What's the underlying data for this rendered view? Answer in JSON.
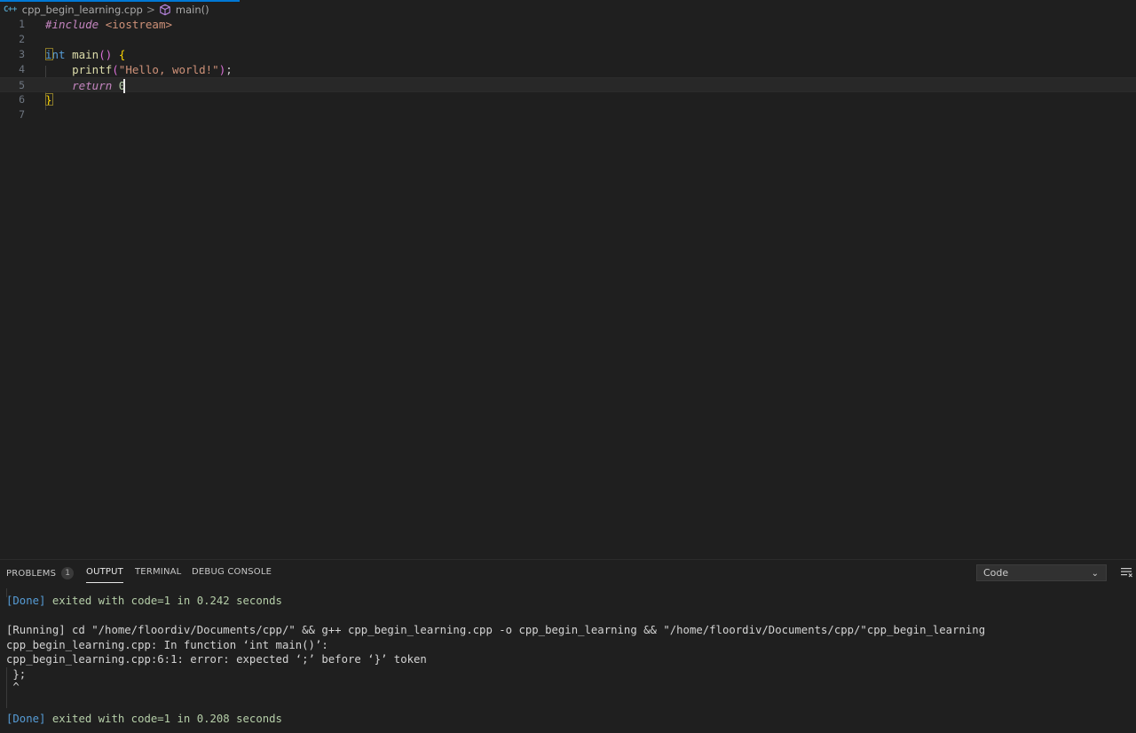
{
  "breadcrumb": {
    "file_icon": "C++",
    "file": "cpp_begin_learning.cpp",
    "separator": ">",
    "symbol": "main()"
  },
  "editor": {
    "line_numbers": [
      "1",
      "2",
      "3",
      "4",
      "5",
      "6",
      "7"
    ],
    "tokens": {
      "l1_directive": "#include",
      "l1_header": "<iostream>",
      "l3_type": "int",
      "l3_fn": "main",
      "l3_parens": "()",
      "l3_brace": "{",
      "l4_fn": "printf",
      "l4_paren_open": "(",
      "l4_string": "\"Hello, world!\"",
      "l4_paren_close": ")",
      "l4_semicolon": ";",
      "l5_return": "return",
      "l5_value": "0",
      "l6_brace": "}"
    }
  },
  "panel": {
    "tabs": {
      "problems": "PROBLEMS",
      "problems_count": "1",
      "output": "OUTPUT",
      "terminal": "TERMINAL",
      "debug_console": "DEBUG CONSOLE"
    },
    "channel_select": "Code",
    "chevron": "⌄"
  },
  "output": {
    "done1_tag": "[Done]",
    "done1_text": " exited with code=1 in 0.242 seconds",
    "run_line": "[Running] cd \"/home/floordiv/Documents/cpp/\" && g++ cpp_begin_learning.cpp -o cpp_begin_learning && \"/home/floordiv/Documents/cpp/\"cpp_begin_learning",
    "err_line1": "cpp_begin_learning.cpp: In function ‘int main()’:",
    "err_line2": "cpp_begin_learning.cpp:6:1: error: expected ‘;’ before ‘}’ token",
    "err_line3": " };",
    "err_line4": " ^",
    "done2_tag": "[Done]",
    "done2_text": " exited with code=1 in 0.208 seconds"
  },
  "icons": {
    "symbol_method": "cube-icon",
    "list": "list-filter-icon"
  },
  "colors": {
    "accent": "#0078d4",
    "background": "#1f1f1f",
    "string": "#ce9178",
    "keyword": "#c586c0",
    "type": "#569cd6",
    "function": "#dcdcaa",
    "bracket": "#ffd700"
  }
}
